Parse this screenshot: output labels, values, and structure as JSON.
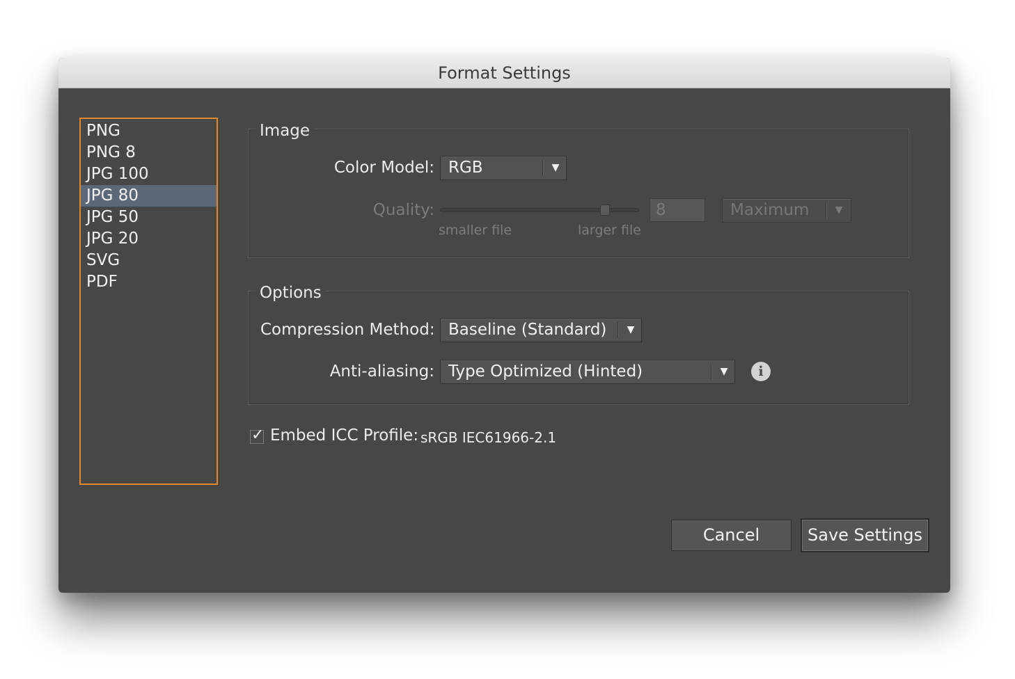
{
  "window": {
    "title": "Format Settings"
  },
  "formats": {
    "items": [
      "PNG",
      "PNG 8",
      "JPG 100",
      "JPG 80",
      "JPG 50",
      "JPG 20",
      "SVG",
      "PDF"
    ],
    "selected_index": 3
  },
  "image_group": {
    "legend": "Image",
    "color_model_label": "Color Model:",
    "color_model_value": "RGB",
    "quality_label": "Quality:",
    "quality_value": "8",
    "quality_preset": "Maximum",
    "quality_fraction": 0.83,
    "smaller_label": "smaller file",
    "larger_label": "larger file"
  },
  "options_group": {
    "legend": "Options",
    "compression_label": "Compression Method:",
    "compression_value": "Baseline (Standard)",
    "antialias_label": "Anti-aliasing:",
    "antialias_value": "Type Optimized (Hinted)",
    "info_icon": "info-icon"
  },
  "icc": {
    "checked": true,
    "label": "Embed ICC Profile:",
    "profile": "sRGB IEC61966-2.1"
  },
  "buttons": {
    "cancel": "Cancel",
    "save": "Save Settings"
  },
  "colors": {
    "dialog_bg": "#474747",
    "selection": "#5c6778",
    "focus_ring": "#e08a2c"
  }
}
